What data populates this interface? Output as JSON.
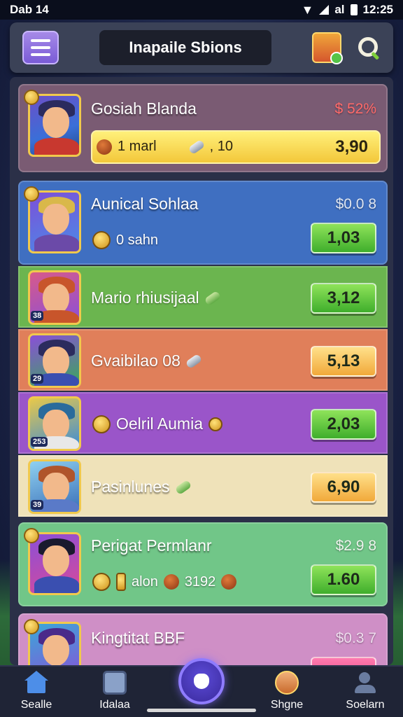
{
  "status_bar": {
    "left": "Dab 14",
    "time": "12:25",
    "carrier": "al"
  },
  "header": {
    "title": "Inapaile Sbions"
  },
  "cards": [
    {
      "name": "Gosiah Blanda",
      "top_right": "$ 52%",
      "top_right_color": "#ff5a5a",
      "sub_text": "1 marl",
      "sub_value": ", 10",
      "price": "3,90",
      "bg": "#7a5b73"
    },
    {
      "name": "Aunical Sohlaa",
      "top_right": "$0.0 8",
      "top_right_color": "#dfe6f2",
      "sub_text": "0 sahn",
      "price": "1,03",
      "bg": "#3f6fc1"
    },
    {
      "name": "Mario rhiusijaal",
      "price": "3,12",
      "bg": "#6bb54f",
      "rank": "38"
    },
    {
      "name": "Gvaibilao 08",
      "price": "5,13",
      "bg": "#e07f5a",
      "rank": "29"
    },
    {
      "name": "Oelril Aumia",
      "price": "2,03",
      "bg": "#9a55c9",
      "rank": "253"
    },
    {
      "name": "Pasinlunes",
      "price": "6,90",
      "bg": "#efe2b9",
      "rank": "39"
    },
    {
      "name": "Perigat Permlanr",
      "top_right": "$2.9 8",
      "top_right_color": "#dfe6f2",
      "sub_text": "alon",
      "sub_value": "3192",
      "price": "1.60",
      "bg": "#71c688"
    },
    {
      "name": "Kingtitat BBF",
      "top_right": "$0.3 7",
      "top_right_color": "#e7d4e8",
      "bg": "#cf8fc6"
    }
  ],
  "bottom_nav": [
    {
      "label": "Sealle",
      "icon": "home-icon"
    },
    {
      "label": "Idalaa",
      "icon": "photo-icon"
    },
    {
      "label": "Shgne",
      "icon": "profile-icon"
    },
    {
      "label": "Soelarn",
      "icon": "people-icon"
    }
  ]
}
